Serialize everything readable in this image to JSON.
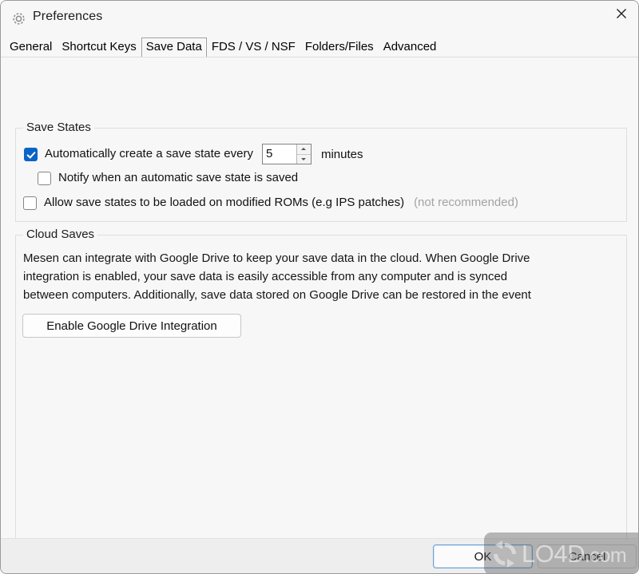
{
  "window": {
    "title": "Preferences",
    "icon": "gear-icon",
    "close_label": "×"
  },
  "tabs": [
    {
      "label": "General",
      "selected": false
    },
    {
      "label": "Shortcut Keys",
      "selected": false
    },
    {
      "label": "Save Data",
      "selected": true
    },
    {
      "label": "FDS / VS / NSF",
      "selected": false
    },
    {
      "label": "Folders/Files",
      "selected": false
    },
    {
      "label": "Advanced",
      "selected": false
    }
  ],
  "save_states": {
    "group_title": "Save States",
    "auto_save": {
      "label": "Automatically create a save state every",
      "checked": true,
      "value": "5",
      "suffix": "minutes"
    },
    "notify": {
      "label": "Notify when an automatic save state is saved",
      "checked": false
    },
    "allow_modified": {
      "label": "Allow save states to be loaded on modified ROMs (e.g IPS patches)",
      "note": "(not recommended)",
      "checked": false
    }
  },
  "cloud_saves": {
    "group_title": "Cloud Saves",
    "description_lines": [
      "Mesen can integrate with Google Drive to keep your save data in the cloud.  When Google Drive",
      "integration is enabled, your save data is easily accessible from any computer and is synced",
      "between computers.  Additionally, save data stored on Google Drive can be restored in the event"
    ],
    "enable_button": "Enable Google Drive Integration"
  },
  "footer": {
    "ok": "OK",
    "cancel": "Cancel"
  },
  "watermark": {
    "text": "LO4D",
    "suffix": ".com",
    "logo": "refresh-circle-icon"
  },
  "colors": {
    "accent": "#0a64c8",
    "window_bg": "#f7f7f7",
    "bottom_bar_bg": "#eeeeee",
    "focus_border": "#6aa0d8",
    "dim_text": "#a3a3a3"
  }
}
